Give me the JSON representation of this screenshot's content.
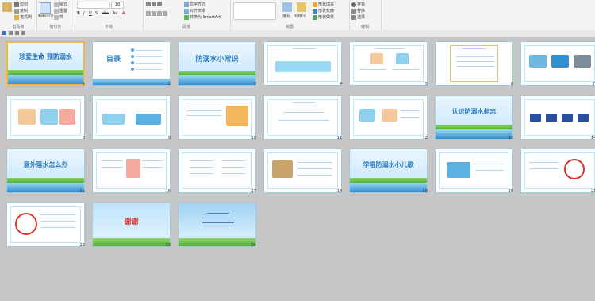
{
  "ribbon": {
    "groups": [
      {
        "label": "剪贴板",
        "items": [
          "剪切",
          "复制",
          "格式刷"
        ]
      },
      {
        "label": "幻灯片",
        "items": [
          "新建幻灯片",
          "版式",
          "重置",
          "节"
        ]
      },
      {
        "label": "字体",
        "items": [
          "B",
          "I",
          "U",
          "S",
          "abc",
          "Aa",
          "A"
        ]
      },
      {
        "label": "段落",
        "items": [
          "文字方向",
          "对齐文本",
          "转换为 SmartArt"
        ]
      },
      {
        "label": "绘图",
        "items": [
          "排列",
          "快速样式",
          "形状填充",
          "形状轮廓",
          "形状效果"
        ]
      },
      {
        "label": "编辑",
        "items": [
          "查找",
          "替换",
          "选择"
        ]
      }
    ],
    "font_size": "18"
  },
  "slides": [
    {
      "num": "1",
      "title": "珍爱生命  预防溺水"
    },
    {
      "num": "2",
      "title": "目录"
    },
    {
      "num": "3",
      "title": "防溺水小常识"
    },
    {
      "num": "4",
      "title": ""
    },
    {
      "num": "5",
      "title": ""
    },
    {
      "num": "6",
      "title": ""
    },
    {
      "num": "7",
      "title": ""
    },
    {
      "num": "8",
      "title": ""
    },
    {
      "num": "9",
      "title": ""
    },
    {
      "num": "10",
      "title": ""
    },
    {
      "num": "11",
      "title": ""
    },
    {
      "num": "12",
      "title": ""
    },
    {
      "num": "13",
      "title": "认识防溺水标志"
    },
    {
      "num": "14",
      "title": ""
    },
    {
      "num": "15",
      "title": "意外落水怎么办"
    },
    {
      "num": "16",
      "title": ""
    },
    {
      "num": "17",
      "title": ""
    },
    {
      "num": "18",
      "title": ""
    },
    {
      "num": "19",
      "title": "学唱防溺水小儿歌"
    },
    {
      "num": "20",
      "title": ""
    },
    {
      "num": "21",
      "title": ""
    },
    {
      "num": "22",
      "title": ""
    },
    {
      "num": "23",
      "title": "谢谢"
    },
    {
      "num": "24",
      "title": ""
    }
  ],
  "colors": {
    "accent": "#f2b84b",
    "title_blue": "#2f7fc1",
    "water": "#2f8fd1",
    "grass": "#4fae3c"
  }
}
